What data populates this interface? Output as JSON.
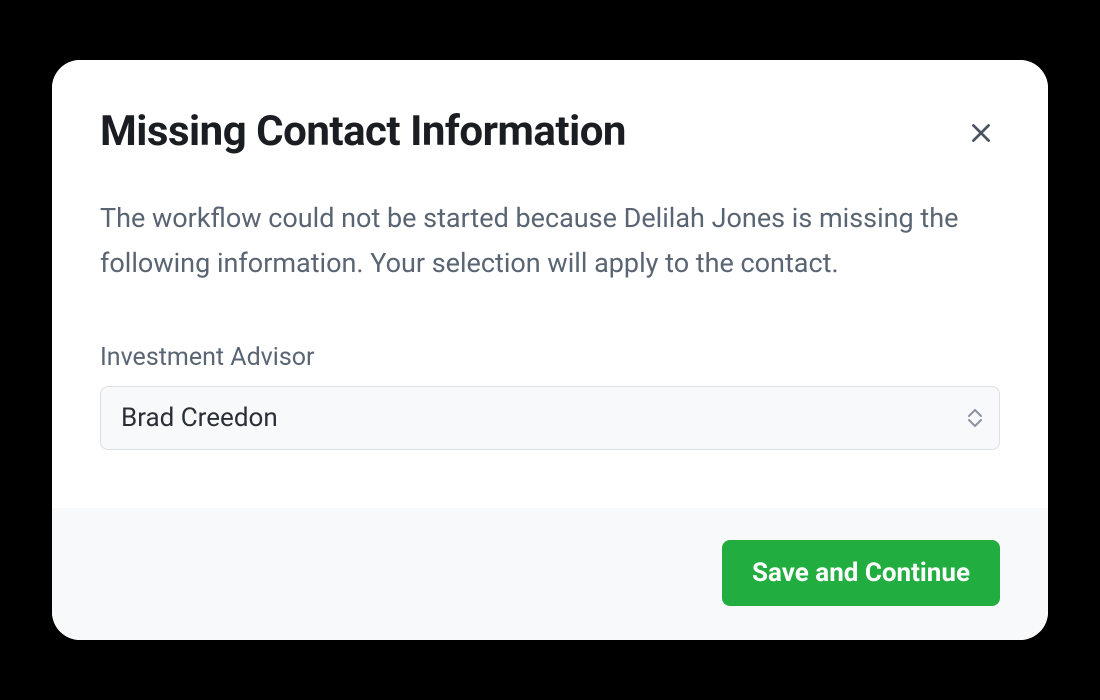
{
  "modal": {
    "title": "Missing Contact Information",
    "description": "The workflow could not be started because Delilah Jones is missing the following information. Your selection will apply to the contact.",
    "field": {
      "label": "Investment Advisor",
      "selected_value": "Brad Creedon"
    },
    "footer": {
      "primary_button_label": "Save and Continue"
    }
  }
}
